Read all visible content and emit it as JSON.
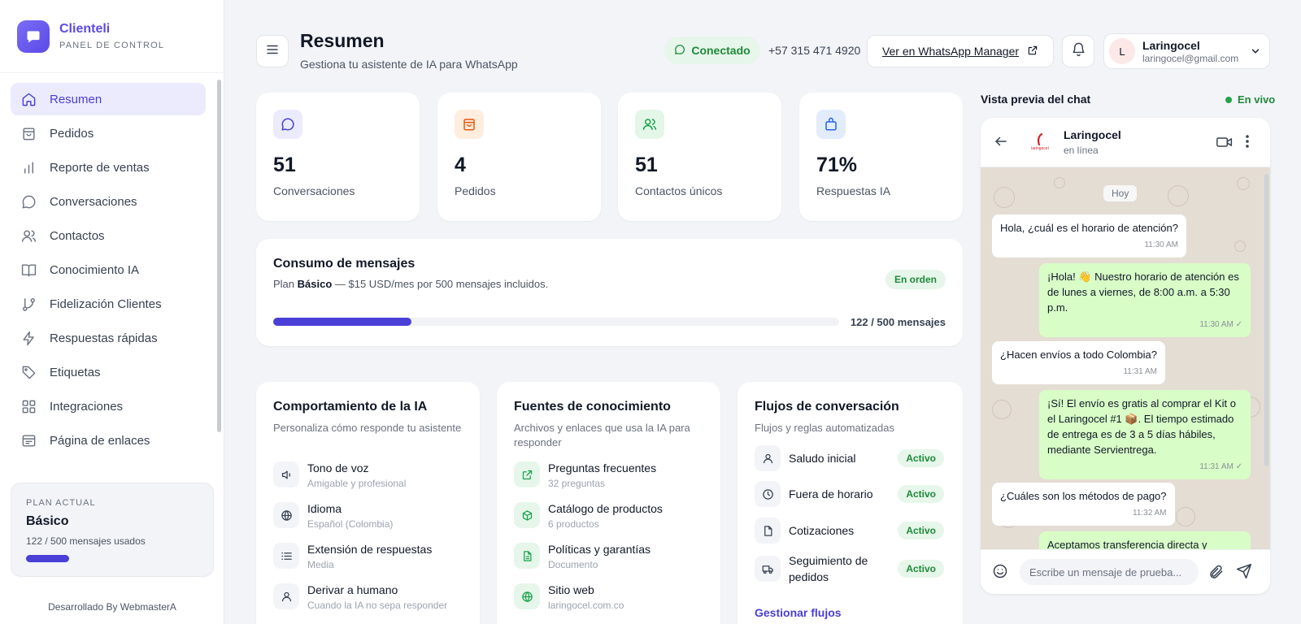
{
  "brand": {
    "name": "Clienteli",
    "subtitle": "PANEL DE CONTROL"
  },
  "sidebar": {
    "items": [
      {
        "label": "Resumen",
        "icon": "home-icon",
        "active": true
      },
      {
        "label": "Pedidos",
        "icon": "shopping-bag-icon"
      },
      {
        "label": "Reporte de ventas",
        "icon": "bar-chart-icon"
      },
      {
        "label": "Conversaciones",
        "icon": "message-circle-icon"
      },
      {
        "label": "Contactos",
        "icon": "users-icon"
      },
      {
        "label": "Conocimiento IA",
        "icon": "book-open-icon"
      },
      {
        "label": "Fidelización Clientes",
        "icon": "git-branch-icon"
      },
      {
        "label": "Respuestas rápidas",
        "icon": "zap-icon"
      },
      {
        "label": "Etiquetas",
        "icon": "tag-icon"
      },
      {
        "label": "Integraciones",
        "icon": "grid-icon"
      },
      {
        "label": "Página de enlaces",
        "icon": "page-layout-icon"
      }
    ],
    "plan": {
      "label": "PLAN ACTUAL",
      "name": "Básico",
      "usage": "122 / 500 mensajes usados",
      "used": 122,
      "total": 500
    },
    "developed_by": "Desarrollado By WebmasterA"
  },
  "header": {
    "title": "Resumen",
    "subtitle": "Gestiona tu asistente de IA para WhatsApp",
    "status": "Conectado",
    "phone": "+57 315 471 4920",
    "wa_button": "Ver en WhatsApp Manager",
    "user": {
      "initial": "L",
      "name": "Laringocel",
      "email": "laringocel@gmail.com"
    }
  },
  "stats": [
    {
      "value": "51",
      "label": "Conversaciones",
      "icon": "message-circle-icon",
      "color": "#4a3fd6",
      "bg": "#ebebfd"
    },
    {
      "value": "4",
      "label": "Pedidos",
      "icon": "shopping-bag-icon",
      "color": "#ea580c",
      "bg": "#ffedde"
    },
    {
      "value": "51",
      "label": "Contactos únicos",
      "icon": "users-icon",
      "color": "#16a34a",
      "bg": "#e3f6e8"
    },
    {
      "value": "71%",
      "label": "Respuestas IA",
      "icon": "briefcase-icon",
      "color": "#2563eb",
      "bg": "#e2ecfd"
    }
  ],
  "consumo": {
    "title": "Consumo de mensajes",
    "plan_prefix": "Plan ",
    "plan_name": "Básico",
    "plan_suffix": " — $15 USD/mes por 500 mensajes incluidos.",
    "badge": "En orden",
    "used": 122,
    "total": 500,
    "progress_text": "122 / 500 mensajes"
  },
  "ia_behavior": {
    "title": "Comportamiento de la IA",
    "subtitle": "Personaliza cómo responde tu asistente",
    "items": [
      {
        "title": "Tono de voz",
        "sub": "Amigable y profesional",
        "icon": "volume-icon"
      },
      {
        "title": "Idioma",
        "sub": "Español (Colombia)",
        "icon": "globe-icon"
      },
      {
        "title": "Extensión de respuestas",
        "sub": "Media",
        "icon": "list-icon"
      },
      {
        "title": "Derivar a humano",
        "sub": "Cuando la IA no sepa responder",
        "icon": "user-icon"
      }
    ]
  },
  "knowledge": {
    "title": "Fuentes de conocimiento",
    "subtitle": "Archivos y enlaces que usa la IA para responder",
    "items": [
      {
        "title": "Preguntas frecuentes",
        "sub": "32 preguntas",
        "icon": "external-link-icon"
      },
      {
        "title": "Catálogo de productos",
        "sub": "6 productos",
        "icon": "box-icon"
      },
      {
        "title": "Políticas y garantías",
        "sub": "Documento",
        "icon": "file-text-icon"
      },
      {
        "title": "Sitio web",
        "sub": "laringocel.com.co",
        "icon": "globe-icon"
      }
    ]
  },
  "flows": {
    "title": "Flujos de conversación",
    "subtitle": "Flujos y reglas automatizadas",
    "items": [
      {
        "name": "Saludo inicial",
        "status": "Activo",
        "icon": "user-icon"
      },
      {
        "name": "Fuera de horario",
        "status": "Activo",
        "icon": "clock-icon"
      },
      {
        "name": "Cotizaciones",
        "status": "Activo",
        "icon": "file-icon"
      },
      {
        "name": "Seguimiento de pedidos",
        "status": "Activo",
        "icon": "truck-icon"
      }
    ],
    "manage_link": "Gestionar flujos"
  },
  "chat": {
    "header": "Vista previa del chat",
    "live": "En vivo",
    "contact": "Laringocel",
    "contact_status": "en línea",
    "logo_text": "laringocel",
    "day": "Hoy",
    "messages": [
      {
        "dir": "in",
        "text": "Hola, ¿cuál es el horario de atención?",
        "time": "11:30 AM"
      },
      {
        "dir": "out",
        "text": "¡Hola! 👋 Nuestro horario de atención es de lunes a viernes, de 8:00 a.m. a 5:30 p.m.",
        "time": "11:30 AM ✓"
      },
      {
        "dir": "in",
        "text": "¿Hacen envíos a todo Colombia?",
        "time": "11:31 AM"
      },
      {
        "dir": "out",
        "text": "¡Sí! El envío es gratis al comprar el Kit o el Laringocel #1 📦. El tiempo estimado de entrega es de 3 a 5 días hábiles, mediante Servientrega.",
        "time": "11:31 AM ✓"
      },
      {
        "dir": "in",
        "text": "¿Cuáles son los métodos de pago?",
        "time": "11:32 AM"
      },
      {
        "dir": "out",
        "text": "Aceptamos transferencia directa y",
        "time": ""
      }
    ],
    "input_placeholder": "Escribe un mensaje de prueba..."
  }
}
